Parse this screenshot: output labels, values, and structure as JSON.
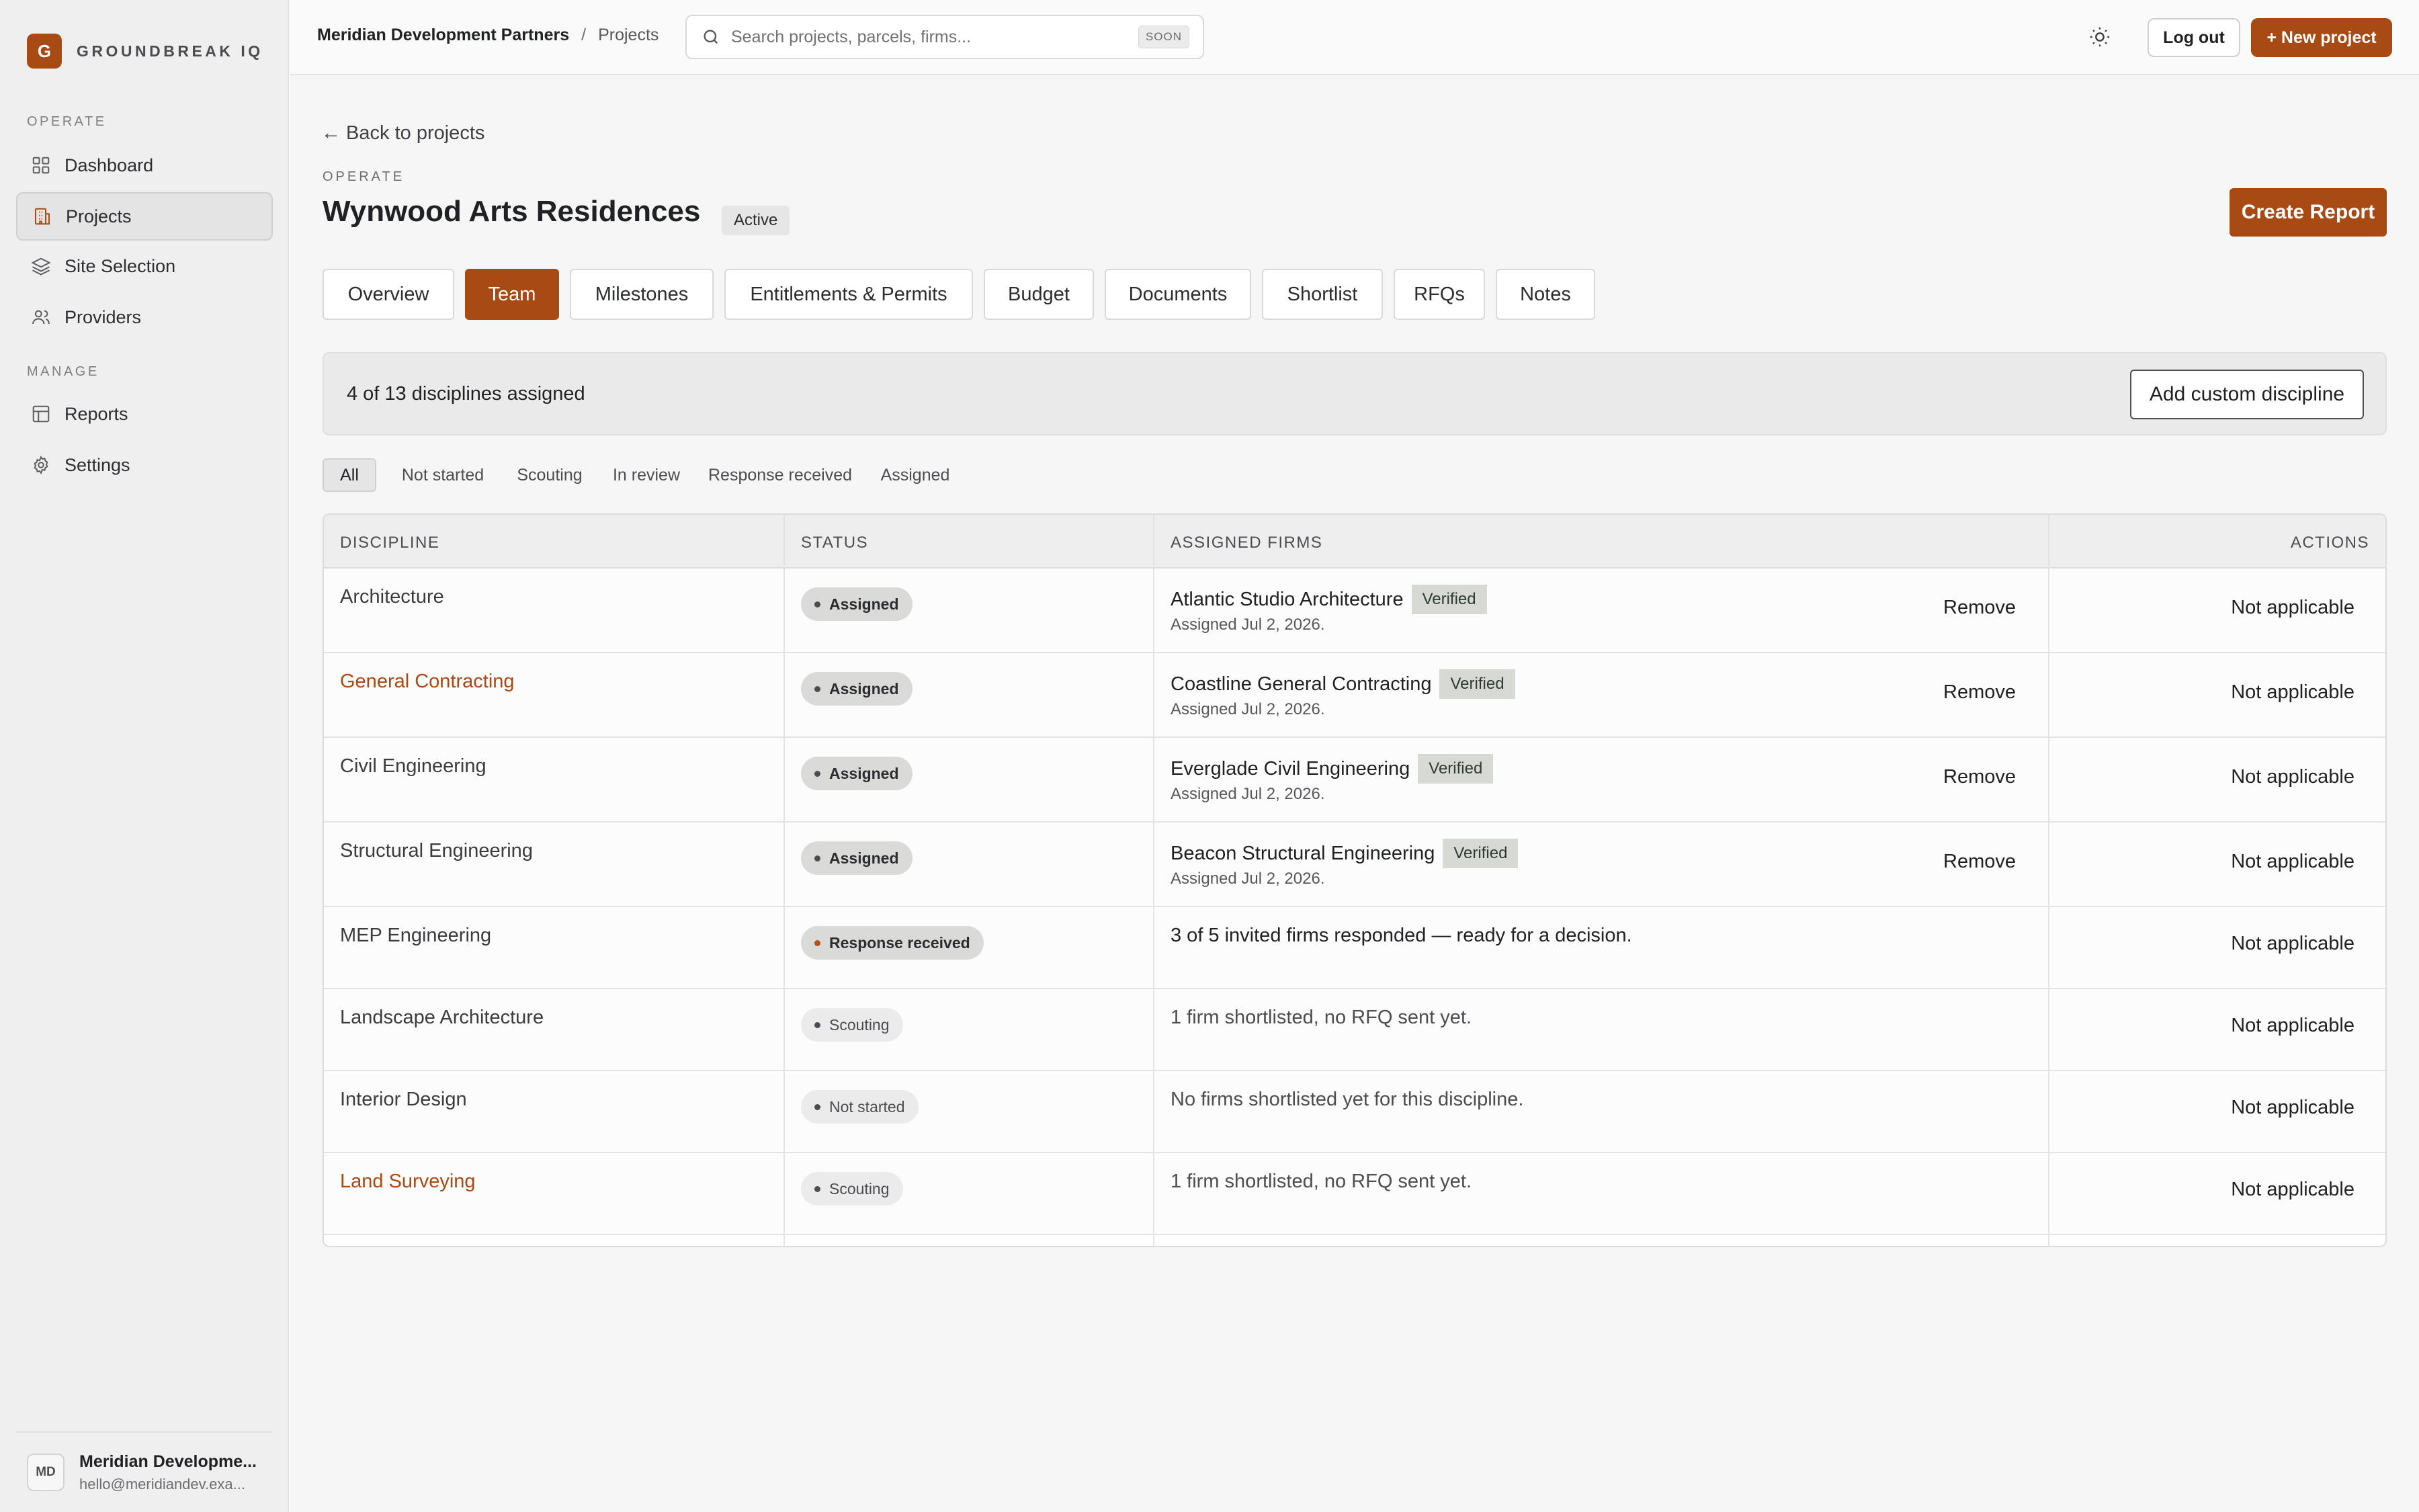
{
  "brand": {
    "initial": "G",
    "name": "GROUNDBREAK IQ"
  },
  "sidebar": {
    "sections": [
      {
        "label": "OPERATE",
        "items": [
          {
            "label": "Dashboard",
            "icon": "grid-icon"
          },
          {
            "label": "Projects",
            "icon": "building-icon",
            "active": true
          },
          {
            "label": "Site Selection",
            "icon": "layers-icon"
          },
          {
            "label": "Providers",
            "icon": "users-icon"
          }
        ]
      },
      {
        "label": "MANAGE",
        "items": [
          {
            "label": "Reports",
            "icon": "table-icon"
          },
          {
            "label": "Settings",
            "icon": "gear-icon"
          }
        ]
      }
    ],
    "user": {
      "initials": "MD",
      "name": "Meridian Developme...",
      "email": "hello@meridiandev.exa..."
    }
  },
  "topbar": {
    "org": "Meridian Development Partners",
    "separator": "/",
    "page": "Projects",
    "search_placeholder": "Search projects, parcels, firms...",
    "search_badge": "SOON",
    "logout_label": "Log out",
    "new_project_label": "+ New project"
  },
  "page": {
    "back_label": "← Back to projects",
    "eyebrow": "OPERATE",
    "title": "Wynwood Arts Residences",
    "status_badge": "Active",
    "create_report_label": "Create Report"
  },
  "tabs": [
    "Overview",
    "Team",
    "Milestones",
    "Entitlements & Permits",
    "Budget",
    "Documents",
    "Shortlist",
    "RFQs",
    "Notes"
  ],
  "active_tab": "Team",
  "summary": {
    "text": "4 of 13 disciplines assigned",
    "add_label": "Add custom discipline"
  },
  "filters": [
    "All",
    "Not started",
    "Scouting",
    "In review",
    "Response received",
    "Assigned"
  ],
  "active_filter": "All",
  "table": {
    "headers": [
      "DISCIPLINE",
      "STATUS",
      "ASSIGNED FIRMS",
      "ACTIONS"
    ],
    "rows": [
      {
        "discipline": "Architecture",
        "link": false,
        "status": "Assigned",
        "firm": "Atlantic Studio Architecture",
        "verified": "Verified",
        "date": "Assigned Jul 2, 2026.",
        "remove": "Remove",
        "action": "Not applicable"
      },
      {
        "discipline": "General Contracting",
        "link": true,
        "status": "Assigned",
        "firm": "Coastline General Contracting",
        "verified": "Verified",
        "date": "Assigned Jul 2, 2026.",
        "remove": "Remove",
        "action": "Not applicable"
      },
      {
        "discipline": "Civil Engineering",
        "link": false,
        "status": "Assigned",
        "firm": "Everglade Civil Engineering",
        "verified": "Verified",
        "date": "Assigned Jul 2, 2026.",
        "remove": "Remove",
        "action": "Not applicable"
      },
      {
        "discipline": "Structural Engineering",
        "link": false,
        "status": "Assigned",
        "firm": "Beacon Structural Engineering",
        "verified": "Verified",
        "date": "Assigned Jul 2, 2026.",
        "remove": "Remove",
        "action": "Not applicable"
      },
      {
        "discipline": "MEP Engineering",
        "link": false,
        "status": "Response received",
        "note": "3 of 5 invited firms responded — ready for a decision.",
        "action": "Not applicable"
      },
      {
        "discipline": "Landscape Architecture",
        "link": false,
        "status": "Scouting",
        "note": "1 firm shortlisted, no RFQ sent yet.",
        "action": "Not applicable"
      },
      {
        "discipline": "Interior Design",
        "link": false,
        "status": "Not started",
        "note": "No firms shortlisted yet for this discipline.",
        "action": "Not applicable"
      },
      {
        "discipline": "Land Surveying",
        "link": true,
        "status": "Scouting",
        "note": "1 firm shortlisted, no RFQ sent yet.",
        "action": "Not applicable"
      }
    ]
  },
  "colors": {
    "accent": "#a84a14",
    "sidebar_bg": "#efefef",
    "page_bg": "#f6f6f6"
  }
}
